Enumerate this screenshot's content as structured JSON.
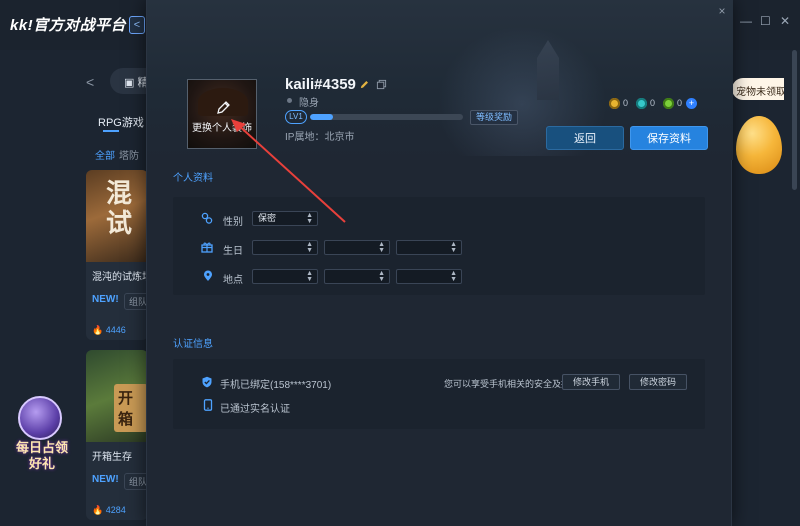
{
  "background_app": {
    "logo": "kk!官方对战平台",
    "back_button": "<",
    "window_controls": [
      "—",
      "☐",
      "✕"
    ],
    "nav_back": "<",
    "nav_pill_label": "▣ 精",
    "category_tab": "RPG游戏",
    "sub_filters": [
      "全部",
      "塔防"
    ],
    "cards": [
      {
        "image_text": "混\n试",
        "title": "混沌的试炼场",
        "new_label": "NEW!",
        "tag": "组队",
        "count": "4446"
      },
      {
        "image_text": "开箱",
        "title": "开箱生存",
        "new_label": "NEW!",
        "tag": "组队",
        "count": "4284"
      }
    ],
    "right_promo": "宠物未领取",
    "left_promo": "每日占领好礼"
  },
  "modal": {
    "close": "×",
    "profile": {
      "avatar_edit_label": "更换个人装饰",
      "username": "kaili#4359",
      "status": "隐身",
      "level": "LV1",
      "xp_progress": 0.15,
      "level_reward_button": "等级奖励",
      "ip_location": "IP属地：北京市",
      "currencies": [
        {
          "icon": "gold-coin-icon",
          "value": "0"
        },
        {
          "icon": "gem-icon",
          "value": "0"
        },
        {
          "icon": "green-coin-icon",
          "value": "0"
        }
      ],
      "back_button": "返回",
      "save_button": "保存资料"
    },
    "personal_info": {
      "section_title": "个人资料",
      "gender_label": "性别",
      "gender_value": "保密",
      "birthday_label": "生日",
      "birthday_values": [
        "",
        "",
        ""
      ],
      "location_label": "地点",
      "location_values": [
        "",
        "",
        ""
      ]
    },
    "verification": {
      "section_title": "认证信息",
      "phone_bound": "手机已绑定(158****3701)",
      "realname": "已通过实名认证",
      "hint": "您可以享受手机相关的安全及提醒服务",
      "change_phone_button": "修改手机",
      "change_password_button": "修改密码"
    }
  },
  "colors": {
    "accent": "#4ea2ff",
    "save": "#2683df",
    "annotation": "#e8403b"
  }
}
